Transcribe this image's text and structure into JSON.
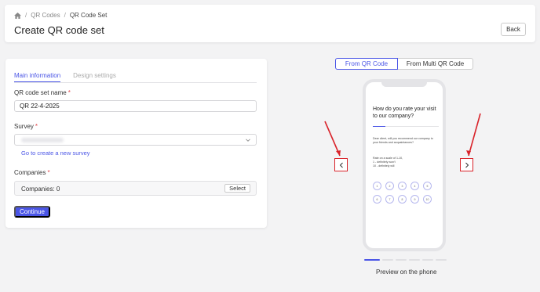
{
  "breadcrumb": {
    "items": [
      "QR Codes",
      "QR Code Set"
    ],
    "separator": "/"
  },
  "header": {
    "title": "Create QR code set",
    "back_label": "Back"
  },
  "tabs": [
    {
      "label": "Main information",
      "active": true
    },
    {
      "label": "Design settings",
      "active": false
    }
  ],
  "form": {
    "name_label": "QR code set name",
    "name_value": "QR 22-4-2025",
    "survey_label": "Survey",
    "survey_link": "Go to create a new survey",
    "companies_label": "Companies",
    "companies_value": "Companies: 0",
    "select_label": "Select",
    "required_mark": "*",
    "continue_label": "Continue"
  },
  "preview": {
    "toggle": [
      {
        "label": "From QR Code",
        "active": true
      },
      {
        "label": "From Multi QR Code",
        "active": false
      }
    ],
    "question": "How do you rate your visit to our company?",
    "body": "Dear client, will you recommend our company to your friends and acquaintances?",
    "scale_note_1": "Rate on a scale of 1-10,",
    "scale_note_2": "1 - definitely won't",
    "scale_note_3": "10 - definitely will",
    "scale_row1": [
      "1",
      "2",
      "3",
      "4",
      "5"
    ],
    "scale_row2": [
      "6",
      "7",
      "8",
      "9",
      "10"
    ],
    "preview_label": "Preview on the phone",
    "active_slide": 1,
    "slide_count": 6
  },
  "colors": {
    "accent": "#4a55e6",
    "annotation": "#d9232a",
    "required": "#e0474c"
  },
  "icons": {
    "home": "home-icon",
    "chevron": "chevron-down-icon",
    "prev": "chevron-left-icon",
    "next": "chevron-right-icon"
  }
}
